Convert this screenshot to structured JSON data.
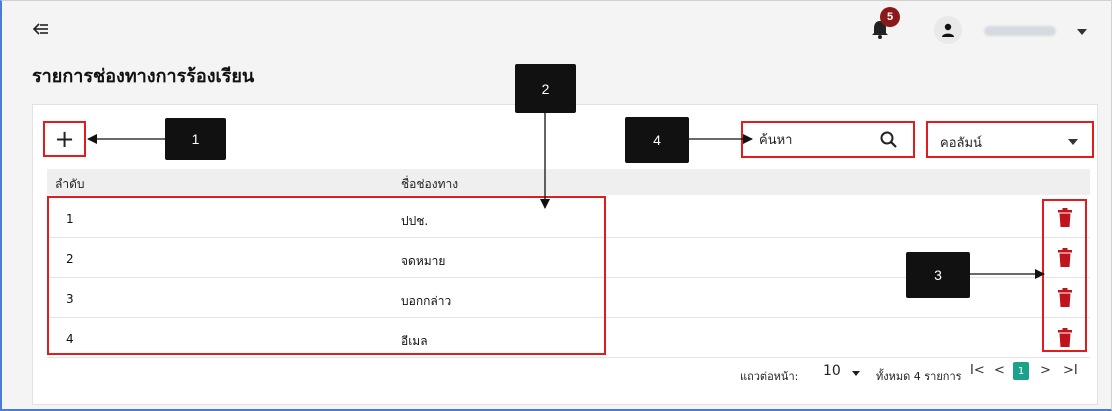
{
  "header": {
    "collapse_icon": "arrow-collapse-icon",
    "notification_count": "5",
    "user_caret_icon": "chevron-down-icon"
  },
  "page": {
    "title": "รายการช่องทางการร้องเรียน"
  },
  "toolbar": {
    "add_label": "+",
    "search_placeholder": "ค้นหา",
    "column_select": "คอลัมน์"
  },
  "table": {
    "columns": [
      "ลำดับ",
      "ชื่อช่องทาง"
    ],
    "rows": [
      {
        "order": "1",
        "name": "ปปช."
      },
      {
        "order": "2",
        "name": "จดหมาย"
      },
      {
        "order": "3",
        "name": "บอกกล่าว"
      },
      {
        "order": "4",
        "name": "อีเมล"
      }
    ]
  },
  "pagination": {
    "rows_per_page_label": "แถวต่อหน้า:",
    "rows_per_page": "10",
    "total_label": "ทั้งหมด 4 รายการ",
    "first": "I<",
    "prev": "<",
    "current_page": "1",
    "next": ">",
    "last": ">I"
  },
  "callouts": [
    "1",
    "2",
    "3",
    "4"
  ],
  "colors": {
    "highlight": "#e21c1c",
    "delete": "#c0141c",
    "active_page": "#1aa38a",
    "badge": "#8a1a1a"
  }
}
